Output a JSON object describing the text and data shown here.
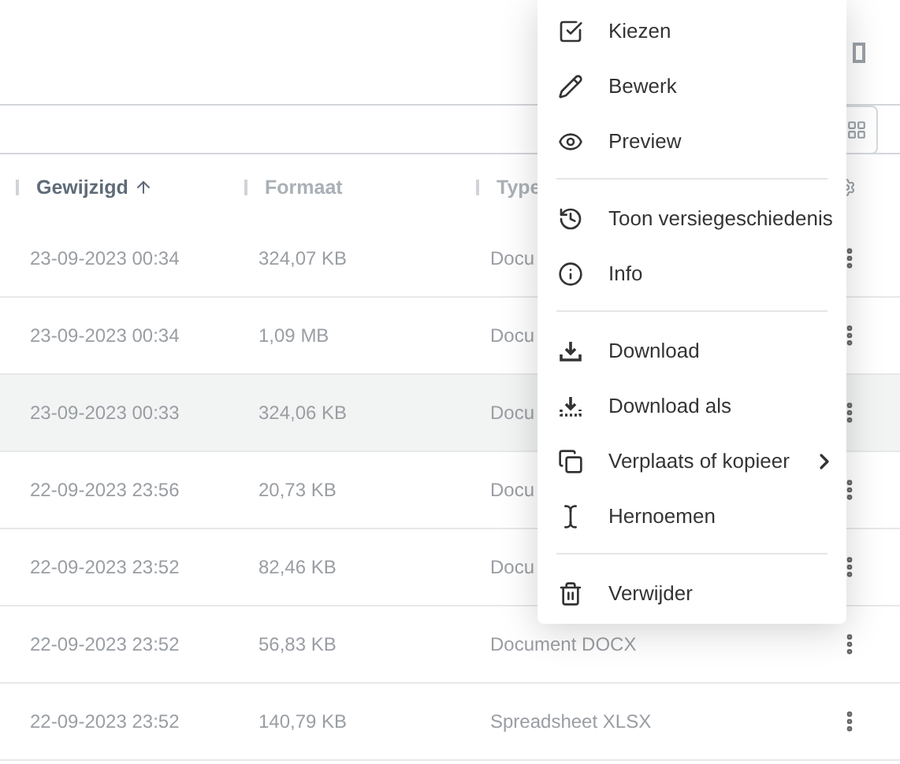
{
  "table": {
    "columns": [
      {
        "label": "Gewijzigd",
        "sorted": true
      },
      {
        "label": "Formaat"
      },
      {
        "label": "Type"
      }
    ],
    "rows": [
      {
        "modified": "23-09-2023 00:34",
        "size": "324,07 KB",
        "type": "Docu",
        "selected": false
      },
      {
        "modified": "23-09-2023 00:34",
        "size": "1,09 MB",
        "type": "Docu",
        "selected": false
      },
      {
        "modified": "23-09-2023 00:33",
        "size": "324,06 KB",
        "type": "Docu",
        "selected": true
      },
      {
        "modified": "22-09-2023 23:56",
        "size": "20,73 KB",
        "type": "Docu",
        "selected": false
      },
      {
        "modified": "22-09-2023 23:52",
        "size": "82,46 KB",
        "type": "Docu",
        "selected": false
      },
      {
        "modified": "22-09-2023 23:52",
        "size": "56,83 KB",
        "type": "Document DOCX",
        "selected": false
      },
      {
        "modified": "22-09-2023 23:52",
        "size": "140,79 KB",
        "type": "Spreadsheet XLSX",
        "selected": false
      }
    ]
  },
  "context_menu": {
    "groups": [
      [
        {
          "label": "Kiezen"
        },
        {
          "label": "Bewerk"
        },
        {
          "label": "Preview"
        }
      ],
      [
        {
          "label": "Toon versiegeschiedenis"
        },
        {
          "label": "Info"
        }
      ],
      [
        {
          "label": "Download"
        },
        {
          "label": "Download als"
        },
        {
          "label": "Verplaats of kopieer",
          "submenu": true
        },
        {
          "label": "Hernoemen"
        }
      ],
      [
        {
          "label": "Verwijder"
        }
      ]
    ]
  }
}
